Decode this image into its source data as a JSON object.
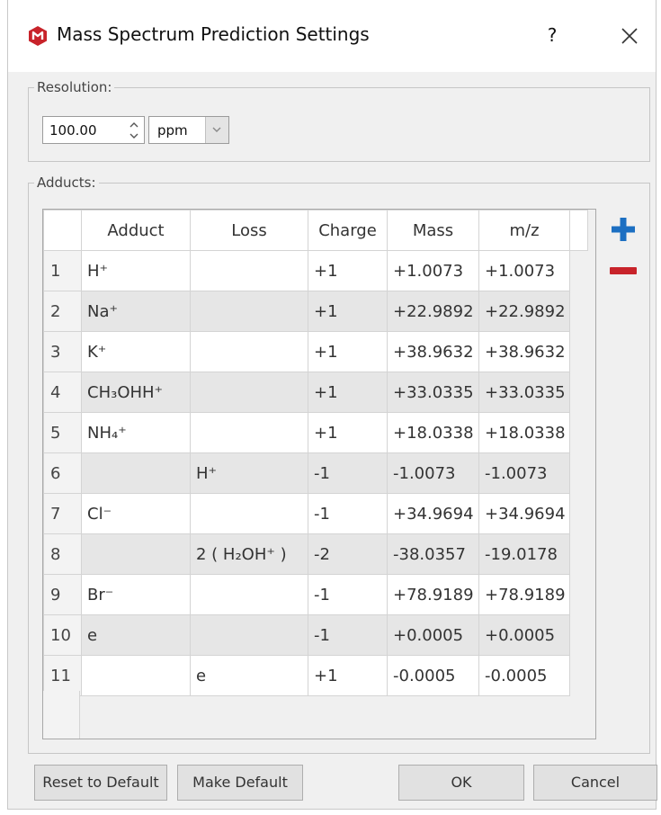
{
  "window": {
    "title": "Mass Spectrum Prediction Settings",
    "help_label": "?",
    "icon": "app-logo-icon",
    "close_icon": "close-icon"
  },
  "resolution": {
    "legend": "Resolution:",
    "value": "100.00",
    "unit": "ppm"
  },
  "adducts": {
    "legend": "Adducts:",
    "columns": [
      "Adduct",
      "Loss",
      "Charge",
      "Mass",
      "m/z"
    ],
    "rows": [
      {
        "n": "1",
        "adduct": "H⁺",
        "loss": "",
        "charge": "+1",
        "mass": "+1.0073",
        "mz": "+1.0073"
      },
      {
        "n": "2",
        "adduct": "Na⁺",
        "loss": "",
        "charge": "+1",
        "mass": "+22.9892",
        "mz": "+22.9892"
      },
      {
        "n": "3",
        "adduct": "K⁺",
        "loss": "",
        "charge": "+1",
        "mass": "+38.9632",
        "mz": "+38.9632"
      },
      {
        "n": "4",
        "adduct": "CH₃OHH⁺",
        "loss": "",
        "charge": "+1",
        "mass": "+33.0335",
        "mz": "+33.0335"
      },
      {
        "n": "5",
        "adduct": "NH₄⁺",
        "loss": "",
        "charge": "+1",
        "mass": "+18.0338",
        "mz": "+18.0338"
      },
      {
        "n": "6",
        "adduct": "",
        "loss": "H⁺",
        "charge": "-1",
        "mass": "-1.0073",
        "mz": "-1.0073"
      },
      {
        "n": "7",
        "adduct": "Cl⁻",
        "loss": "",
        "charge": "-1",
        "mass": "+34.9694",
        "mz": "+34.9694"
      },
      {
        "n": "8",
        "adduct": "",
        "loss": "2 ( H₂OH⁺ )",
        "charge": "-2",
        "mass": "-38.0357",
        "mz": "-19.0178"
      },
      {
        "n": "9",
        "adduct": "Br⁻",
        "loss": "",
        "charge": "-1",
        "mass": "+78.9189",
        "mz": "+78.9189"
      },
      {
        "n": "10",
        "adduct": "e",
        "loss": "",
        "charge": "-1",
        "mass": "+0.0005",
        "mz": "+0.0005"
      },
      {
        "n": "11",
        "adduct": "",
        "loss": "e",
        "charge": "+1",
        "mass": "-0.0005",
        "mz": "-0.0005"
      }
    ],
    "add_icon": "plus-icon",
    "remove_icon": "minus-icon"
  },
  "buttons": {
    "reset": "Reset to Default",
    "make_default": "Make Default",
    "ok": "OK",
    "cancel": "Cancel"
  },
  "colors": {
    "add_blue": "#1c6fc2",
    "remove_red": "#c8232a",
    "logo_red": "#c8232a"
  }
}
